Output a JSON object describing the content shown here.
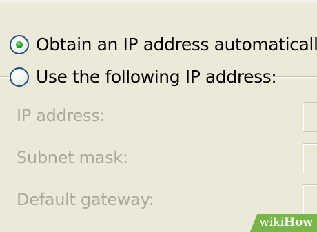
{
  "options": {
    "automatic": {
      "label": "Obtain an IP address automatically",
      "checked": true
    },
    "manual": {
      "label": "Use the following IP address:",
      "checked": false
    }
  },
  "fields": [
    {
      "label": "IP address:",
      "value": ""
    },
    {
      "label": "Subnet mask:",
      "value": ""
    },
    {
      "label": "Default gateway:",
      "value": ""
    }
  ],
  "watermark": {
    "part1": "wiki",
    "part2": "How"
  },
  "colors": {
    "dialog_background": "#ece9d8",
    "disabled_text": "#aca899",
    "radio_selected": "#21a121",
    "radio_border": "#1c5180",
    "watermark_badge": "#79b64a"
  }
}
